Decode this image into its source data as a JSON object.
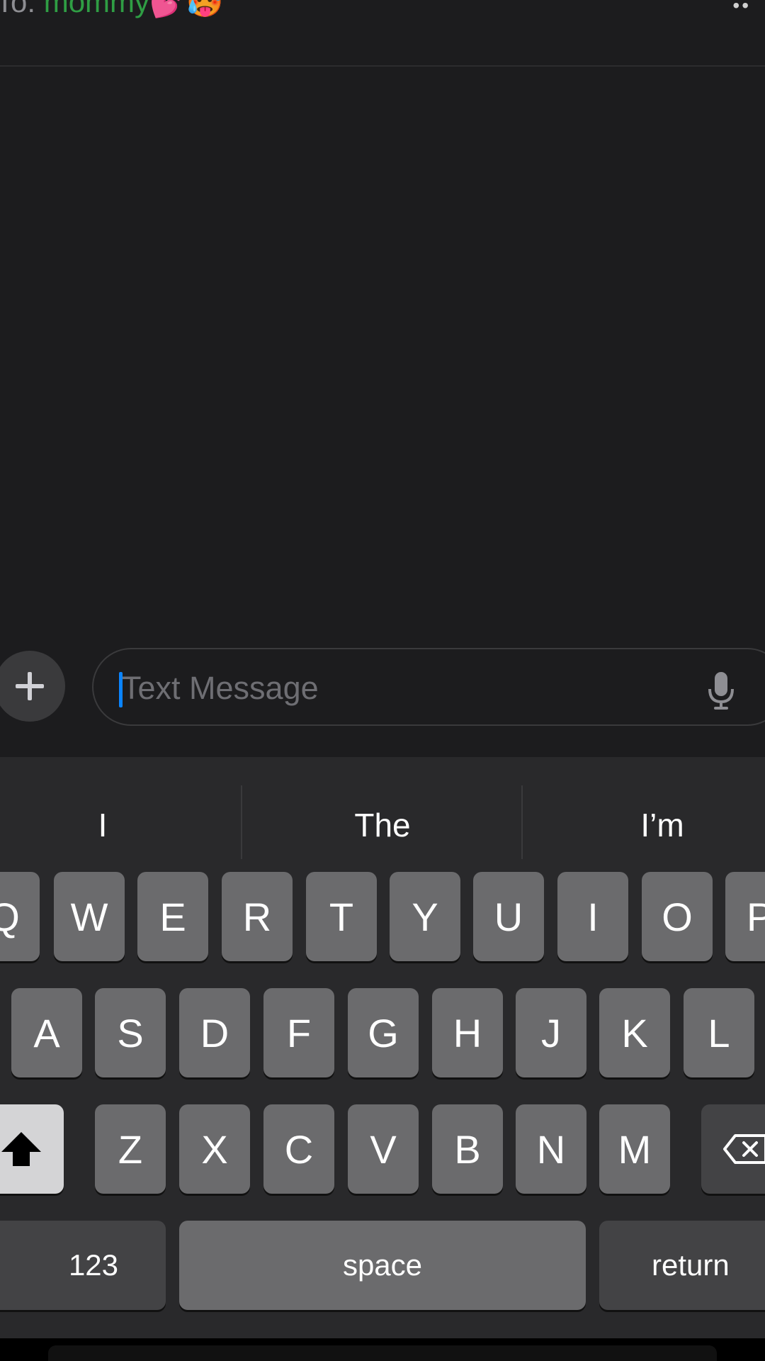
{
  "header": {
    "to_label": "To:",
    "recipient_name": "mommy",
    "recipient_emoji": "💕🥵",
    "corner_glyph": "••"
  },
  "composer": {
    "add_icon": "plus-icon",
    "placeholder": "Text Message",
    "mic_icon": "microphone-icon"
  },
  "keyboard": {
    "suggestions": [
      "I",
      "The",
      "I’m"
    ],
    "row1": [
      "Q",
      "W",
      "E",
      "R",
      "T",
      "Y",
      "U",
      "I",
      "O",
      "P"
    ],
    "row2": [
      "A",
      "S",
      "D",
      "F",
      "G",
      "H",
      "J",
      "K",
      "L"
    ],
    "row3": [
      "Z",
      "X",
      "C",
      "V",
      "B",
      "N",
      "M"
    ],
    "shift_icon": "shift-arrow-icon",
    "delete_icon": "backspace-icon",
    "numbers_label": "123",
    "space_label": "space",
    "return_label": "return"
  },
  "colors": {
    "background": "#1c1c1e",
    "keyboard_bg": "#29292b",
    "key": "#6b6b6d",
    "cursor": "#0a84ff",
    "recipient": "#2f9e44"
  }
}
